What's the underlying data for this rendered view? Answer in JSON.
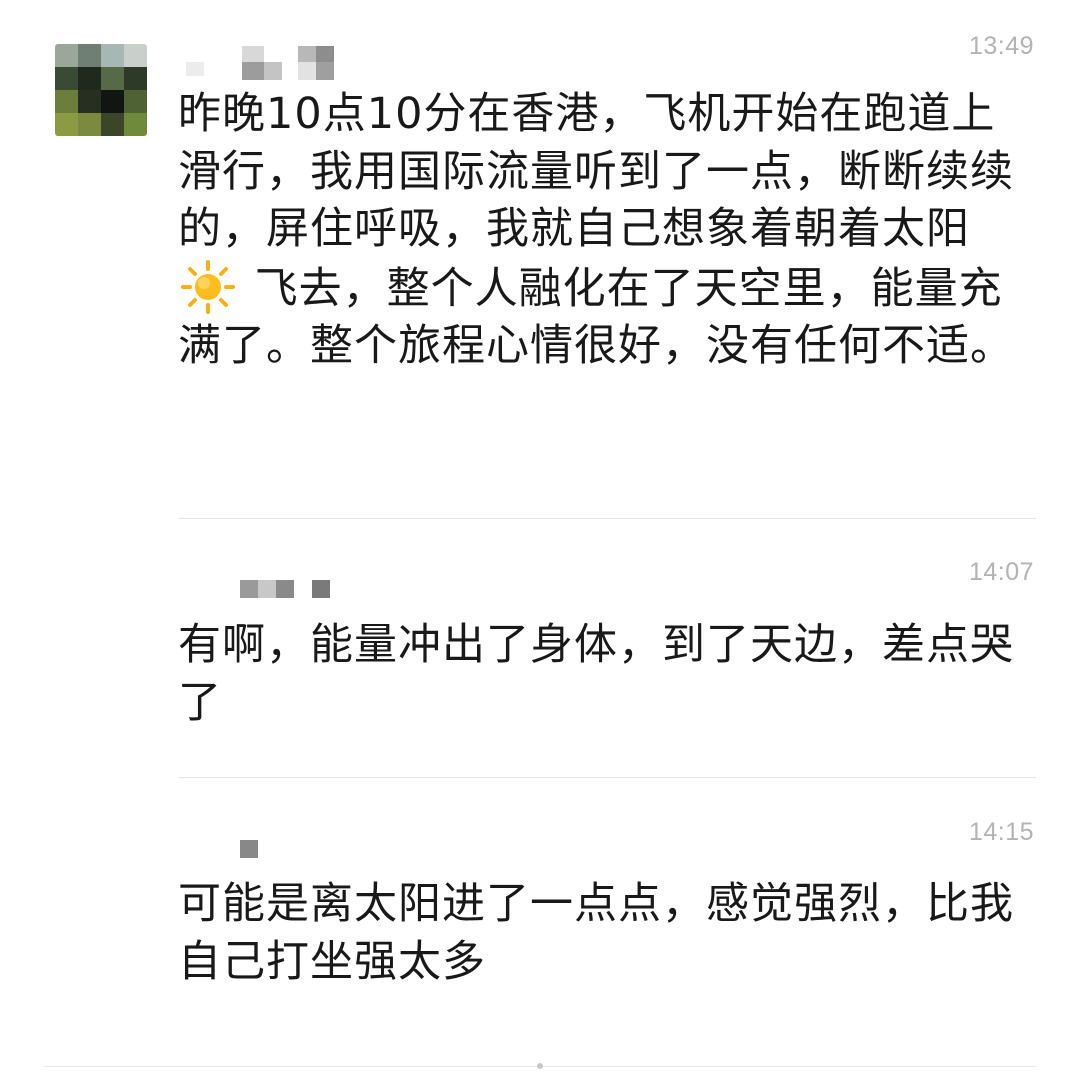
{
  "messages": [
    {
      "time": "13:49",
      "text_before_icon": "昨晚10点10分在香港，飞机开始在跑道上滑行，我用国际流量听到了一点，断断续续的，屏住呼吸，我就自己想象着朝着太阳",
      "icon": "sun-icon",
      "text_after_icon": " 飞去，整个人融化在了天空里，能量充满了。整个旅程心情很好，没有任何不适。"
    },
    {
      "time": "14:07",
      "text": "有啊，能量冲出了身体，到了天边，差点哭了"
    },
    {
      "time": "14:15",
      "text": "可能是离太阳进了一点点，感觉强烈，比我自己打坐强太多"
    }
  ]
}
